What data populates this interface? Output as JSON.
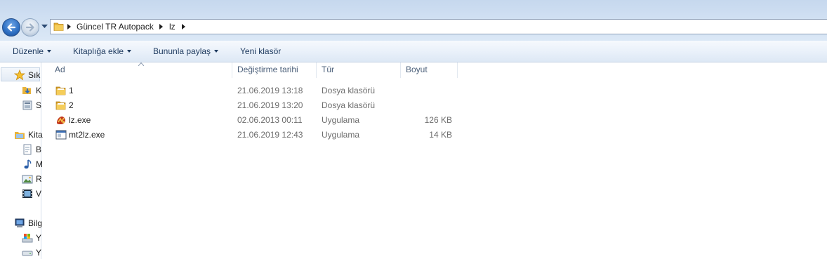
{
  "address": {
    "breadcrumbs": [
      "Güncel TR Autopack",
      "lz"
    ]
  },
  "toolbar": {
    "organize": "Düzenle",
    "add_to_library": "Kitaplığa ekle",
    "share_with": "Bununla paylaş",
    "new_folder": "Yeni klasör"
  },
  "navpane": {
    "favorites": "Sık",
    "fav_items": [
      "K",
      "S"
    ],
    "libraries": "Kita",
    "lib_items": [
      "B",
      "M",
      "R",
      "V"
    ],
    "computer": "Bilg",
    "comp_items": [
      "Y",
      "Y"
    ]
  },
  "columns": {
    "name": "Ad",
    "date": "Değiştirme tarihi",
    "type": "Tür",
    "size": "Boyut"
  },
  "files": [
    {
      "name": "1",
      "date": "21.06.2019 13:18",
      "type": "Dosya klasörü",
      "size": "",
      "icon": "folder-icon"
    },
    {
      "name": "2",
      "date": "21.06.2019 13:20",
      "type": "Dosya klasörü",
      "size": "",
      "icon": "folder-icon"
    },
    {
      "name": "lz.exe",
      "date": "02.06.2013 00:11",
      "type": "Uygulama",
      "size": "126 KB",
      "icon": "lz-app-icon"
    },
    {
      "name": "mt2lz.exe",
      "date": "21.06.2019 12:43",
      "type": "Uygulama",
      "size": "14 KB",
      "icon": "exe-window-icon"
    }
  ]
}
